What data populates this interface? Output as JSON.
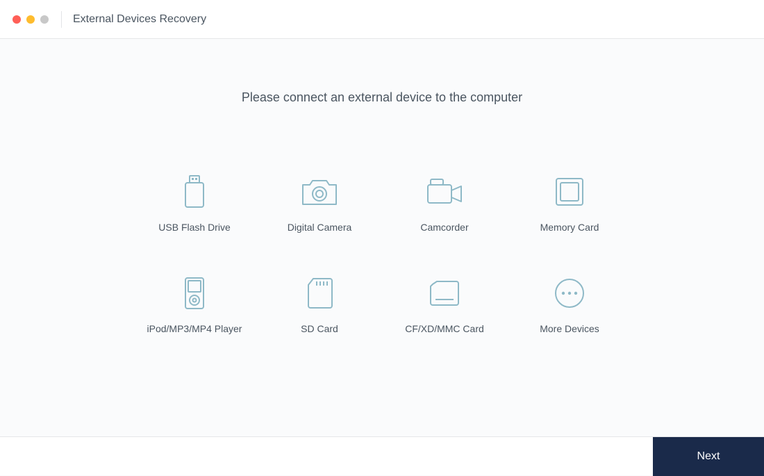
{
  "header": {
    "title": "External Devices Recovery"
  },
  "main": {
    "prompt": "Please connect an external device to the computer"
  },
  "devices": [
    {
      "label": "USB Flash Drive"
    },
    {
      "label": "Digital Camera"
    },
    {
      "label": "Camcorder"
    },
    {
      "label": "Memory Card"
    },
    {
      "label": "iPod/MP3/MP4 Player"
    },
    {
      "label": "SD Card"
    },
    {
      "label": "CF/XD/MMC Card"
    },
    {
      "label": "More Devices"
    }
  ],
  "footer": {
    "next_label": "Next"
  },
  "colors": {
    "icon_stroke": "#8eb9c7",
    "accent": "#1a2a4a"
  }
}
